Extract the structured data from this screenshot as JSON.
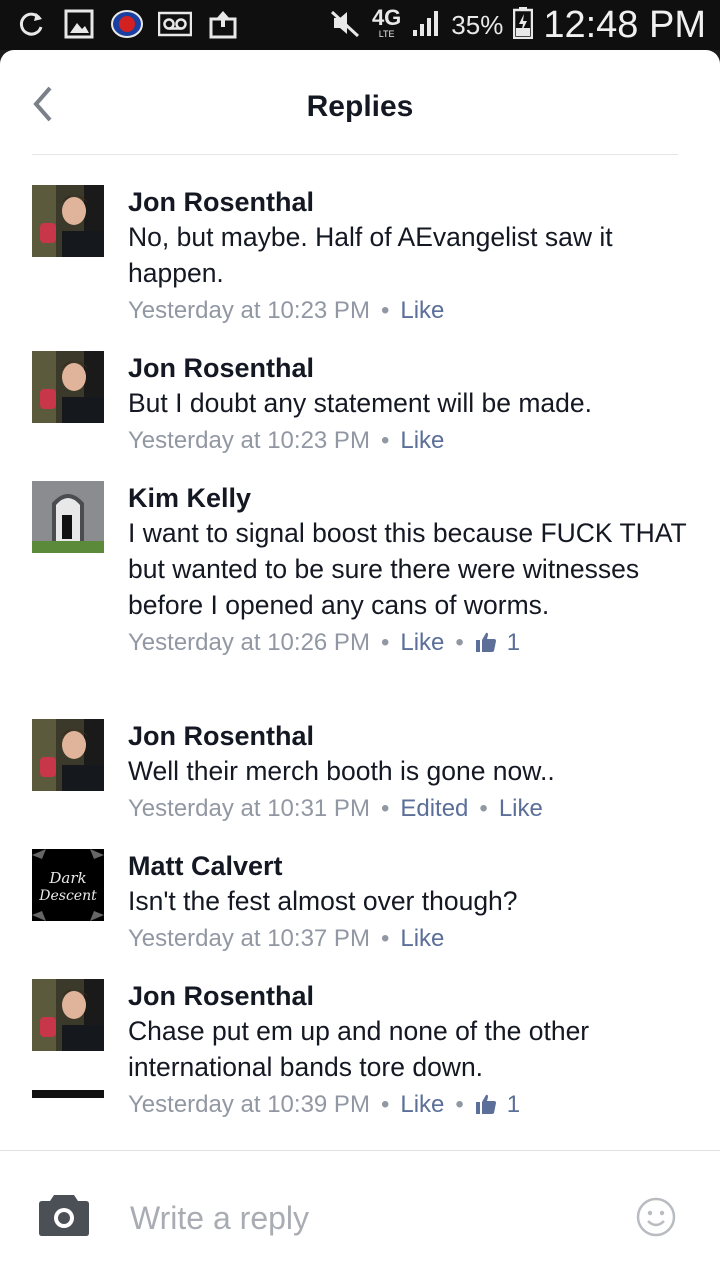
{
  "status_bar": {
    "network": "4G",
    "network_sub": "LTE",
    "battery": "35%",
    "time": "12:48 PM"
  },
  "header": {
    "title": "Replies"
  },
  "comments": [
    {
      "author": "Jon Rosenthal",
      "text": "No, but maybe. Half of AEvangelist saw it happen.",
      "timestamp": "Yesterday at 10:23 PM",
      "like_label": "Like",
      "avatar": "jon-avatar"
    },
    {
      "author": "Jon Rosenthal",
      "text": "But I doubt any statement will be made.",
      "timestamp": "Yesterday at 10:23 PM",
      "like_label": "Like",
      "avatar": "jon-avatar"
    },
    {
      "author": "Kim Kelly",
      "text": "I want to signal boost this because FUCK THAT but wanted to be sure there were witnesses before I opened any cans of worms.",
      "timestamp": "Yesterday at 10:26 PM",
      "like_label": "Like",
      "like_count": "1",
      "avatar": "kim-avatar"
    },
    {
      "author": "Jon Rosenthal",
      "text": "Well their merch booth is gone now..",
      "timestamp": "Yesterday at 10:31 PM",
      "edited_label": "Edited",
      "like_label": "Like",
      "avatar": "jon-avatar"
    },
    {
      "author": "Matt Calvert",
      "text": "Isn't the fest almost over though?",
      "timestamp": "Yesterday at 10:37 PM",
      "like_label": "Like",
      "avatar": "matt-avatar",
      "avatar_text_1": "Dark",
      "avatar_text_2": "Descent"
    },
    {
      "author": "Jon Rosenthal",
      "text": "Chase put em up and none of the other international bands tore down.",
      "timestamp": "Yesterday at 10:39 PM",
      "like_label": "Like",
      "like_count": "1",
      "avatar": "jon-avatar"
    }
  ],
  "composer": {
    "placeholder": "Write a reply",
    "camera_icon": "camera-icon",
    "emoji_icon": "smiley-icon"
  },
  "colors": {
    "text": "#141823",
    "meta": "#9197a3",
    "link": "#5b6f99",
    "status_bar": "#0f0f0f"
  }
}
